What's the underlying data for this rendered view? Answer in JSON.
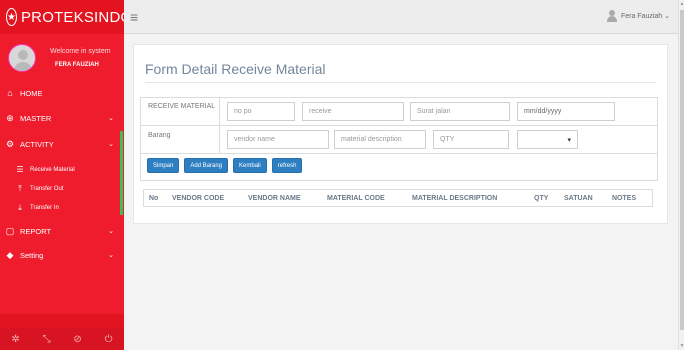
{
  "brand": {
    "name": "PROTEKSINDO",
    "logo_icon": "star-badge"
  },
  "profile": {
    "welcome": "Welcome in system",
    "username": "FERA FAUZIAH"
  },
  "menu": [
    {
      "label": "HOME",
      "icon": "home-icon"
    },
    {
      "label": "MASTER",
      "icon": "globe-icon"
    },
    {
      "label": "ACTIVITY",
      "icon": "cogs-icon"
    },
    {
      "label": "Receive Material",
      "icon": "list-icon"
    },
    {
      "label": "Transfer Out",
      "icon": "upload-icon"
    },
    {
      "label": "Transfer In",
      "icon": "download-icon"
    },
    {
      "label": "REPORT",
      "icon": "file-icon"
    },
    {
      "label": "Setting",
      "icon": "shield-icon"
    }
  ],
  "topbar": {
    "user": "Fera Fauziah ⌄"
  },
  "form": {
    "title": "Form Detail Receive Material",
    "row1_label": "RECEIVE MATERIAL",
    "row2_label": "Barang",
    "no_po_placeholder": "no po",
    "receive_placeholder": "receive",
    "surat_jalan_placeholder": "Surat jalan",
    "date_placeholder": "mm/dd/yyyy",
    "vendor_name_placeholder": "vendor name",
    "material_description_placeholder": "material description",
    "qty_placeholder": "QTY",
    "select_value": ""
  },
  "buttons": {
    "simpan": "Simpan",
    "add_barang": "Add Barang",
    "kembali": "Kembali",
    "refresh": "refresh"
  },
  "table": {
    "headers": [
      "No",
      "VENDOR CODE",
      "VENDOR NAME",
      "MATERIAL CODE",
      "MATERIAL DESCRIPTION",
      "QTY",
      "SATUAN",
      "NOTES"
    ]
  },
  "colors": {
    "sidebar": "#ee1c2d",
    "button": "#2e7fc1",
    "active_indicator": "#3bbf5a"
  }
}
